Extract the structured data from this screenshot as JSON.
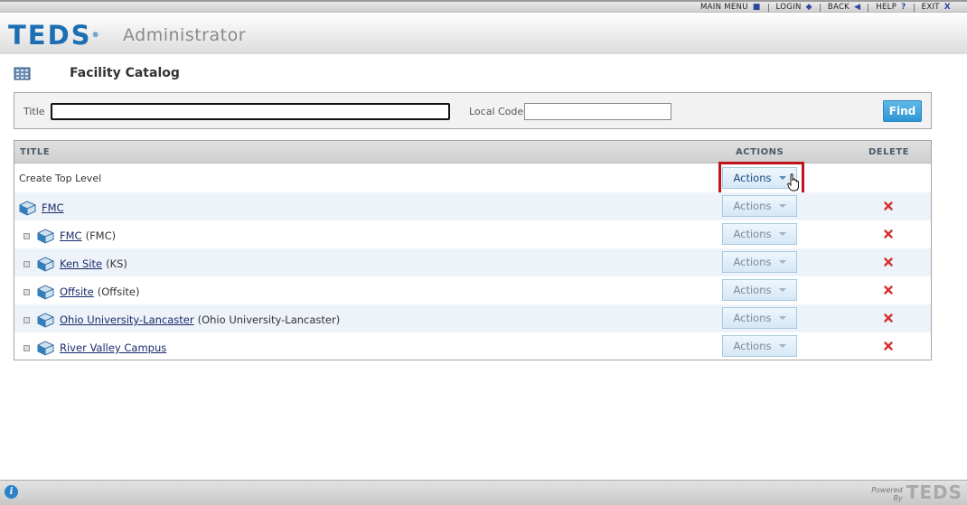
{
  "topmenu": {
    "main_menu": "MAIN MENU",
    "login": "LOGIN",
    "back": "BACK",
    "help": "HELP",
    "help_icon": "?",
    "exit": "EXIT",
    "exit_icon": "X"
  },
  "header": {
    "logo": "TEDS",
    "logo_mark": "®",
    "app_name": "Administrator"
  },
  "page": {
    "title": "Facility Catalog"
  },
  "search": {
    "title_label": "Title",
    "title_value": "",
    "local_code_label": "Local Code",
    "local_code_value": "",
    "find_label": "Find"
  },
  "table": {
    "headers": {
      "title": "TITLE",
      "actions": "ACTIONS",
      "delete": "DELETE"
    },
    "create_top_level": "Create Top Level",
    "actions_label": "Actions",
    "rows": [
      {
        "name": "FMC",
        "code": ""
      },
      {
        "name": "FMC",
        "code": "(FMC)"
      },
      {
        "name": "Ken Site",
        "code": "(KS)"
      },
      {
        "name": "Offsite",
        "code": "(Offsite)"
      },
      {
        "name": "Ohio University-Lancaster",
        "code": "(Ohio University-Lancaster)"
      },
      {
        "name": "River Valley Campus",
        "code": ""
      }
    ]
  },
  "footer": {
    "info_icon": "i",
    "powered_by_line1": "Powered",
    "powered_by_line2": "By",
    "powered_logo": "TEDS"
  },
  "colors": {
    "brand_blue": "#1c6fb3",
    "find_button": "#2f96d4",
    "highlight_red": "#c0141c",
    "delete_red": "#d43030"
  },
  "icons": {
    "page_title": "building-grid-icon",
    "facility": "facility-building-icon",
    "delete": "delete-x-icon",
    "cursor": "hand-pointer-icon"
  }
}
